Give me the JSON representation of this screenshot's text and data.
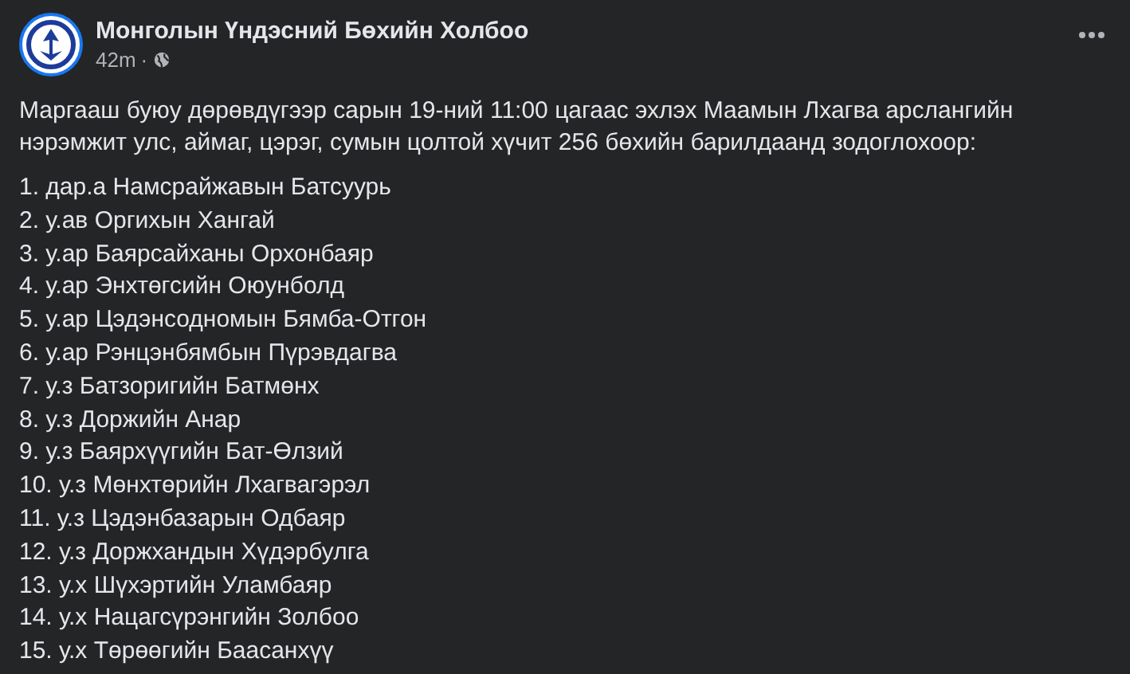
{
  "post": {
    "author": "Монголын Үндэсний Бөхийн Холбоо",
    "time": "42m",
    "separator": "·",
    "text": "Маргааш буюу дөрөвдүгээр сарын 19-ний 11:00 цагаас эхлэх Маамын Лхагва арслангийн нэрэмжит улс, аймаг, цэрэг, сумын цолтой хүчит 256 бөхийн барилдаанд зодоглохоор:",
    "list": [
      "1. дар.а Намсрайжавын Батсуурь",
      "2. у.ав Оргихын Хангай",
      "3. у.ар Баярсайханы Орхонбаяр",
      "4. у.ар Энхтөгсийн Оюунболд",
      "5. у.ар Цэдэнсодномын Бямба-Отгон",
      "6. у.ар Рэнцэнбямбын Пүрэвдагва",
      "7. у.з Батзоригийн Батмөнх",
      "8. у.з Доржийн Анар",
      "9. у.з Баярхүүгийн Бат-Өлзий",
      "10. у.з Мөнхтөрийн Лхагвагэрэл",
      "11. у.з Цэдэнбазарын Одбаяр",
      "12. у.з Доржхандын Хүдэрбулга",
      "13. у.х Шүхэртийн Уламбаяр",
      "14. у.х Нацагсүрэнгийн Золбоо",
      "15. у.х Төрөөгийн Баасанхүү"
    ]
  }
}
